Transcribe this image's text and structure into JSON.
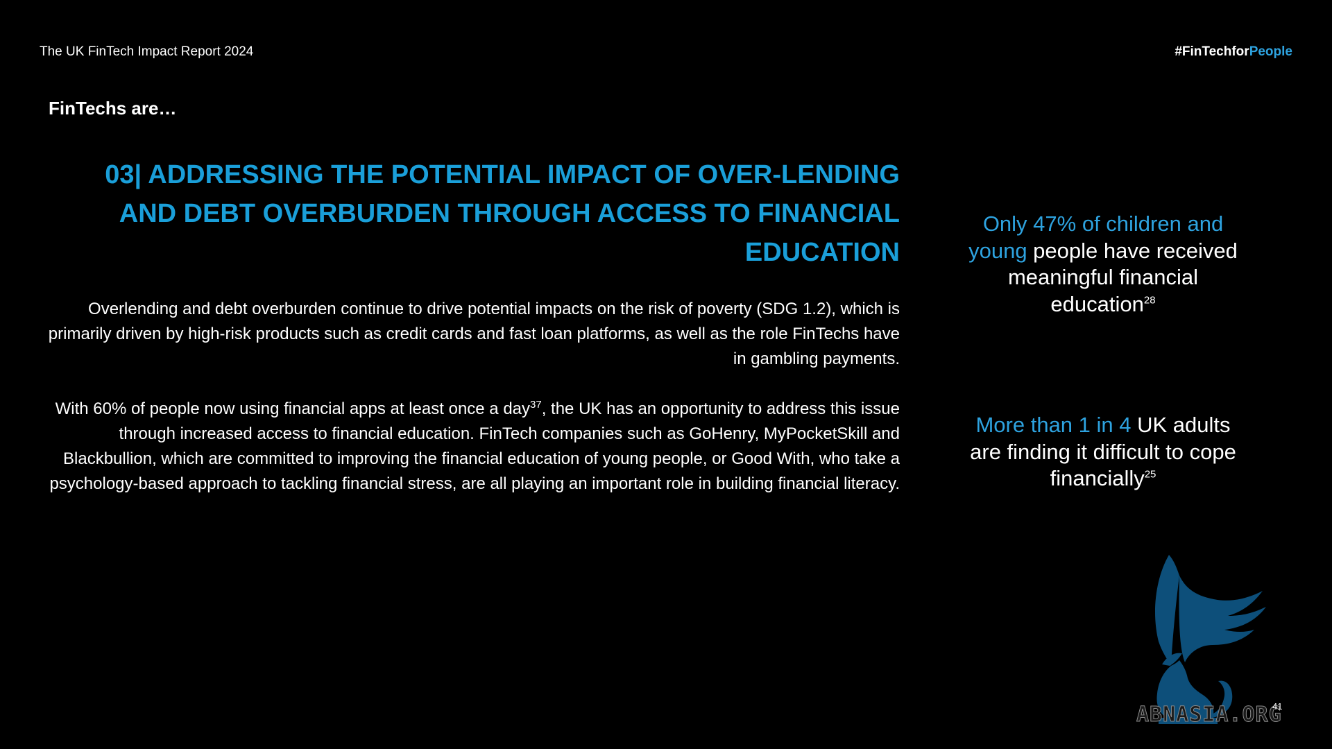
{
  "header": {
    "report_title": "The UK FinTech Impact Report 2024",
    "hashtag_prefix": "#FinTechfor",
    "hashtag_accent": "People"
  },
  "section_label": "FinTechs are…",
  "title": "03| ADDRESSING THE POTENTIAL IMPACT OF OVER-LENDING AND DEBT OVERBURDEN THROUGH ACCESS TO FINANCIAL EDUCATION",
  "paragraph1": "Overlending and debt overburden continue to drive potential impacts on the risk of poverty (SDG 1.2), which is primarily driven by high-risk products such as credit cards and fast loan platforms, as well as the role FinTechs have in gambling payments.",
  "paragraph2": {
    "part1": "With 60% of people now using financial apps at least once a day",
    "footnote": "37",
    "part2": ", the UK has an opportunity to address this issue through increased access to financial education. FinTech companies such as GoHenry, MyPocketSkill and Blackbullion, which are committed to improving the financial education of young people, or Good With, who take a psychology-based approach to tackling financial stress, are all playing an important role in building financial literacy."
  },
  "stat1": {
    "highlight": "Only 47% of children and young",
    "rest": " people have received meaningful financial education",
    "footnote": "28"
  },
  "stat2": {
    "highlight": "More than 1 in 4",
    "rest": " UK adults are finding it difficult to cope financially",
    "footnote": "25"
  },
  "watermark": "ABNASIA.ORG",
  "page_number": "41",
  "colors": {
    "background": "#000000",
    "title_blue": "#1a9fd9",
    "accent_blue": "#2ea3e0",
    "logo_blue": "#0d4f7a",
    "text": "#ffffff"
  },
  "icons": {
    "logo": "griffin-logo-icon"
  }
}
